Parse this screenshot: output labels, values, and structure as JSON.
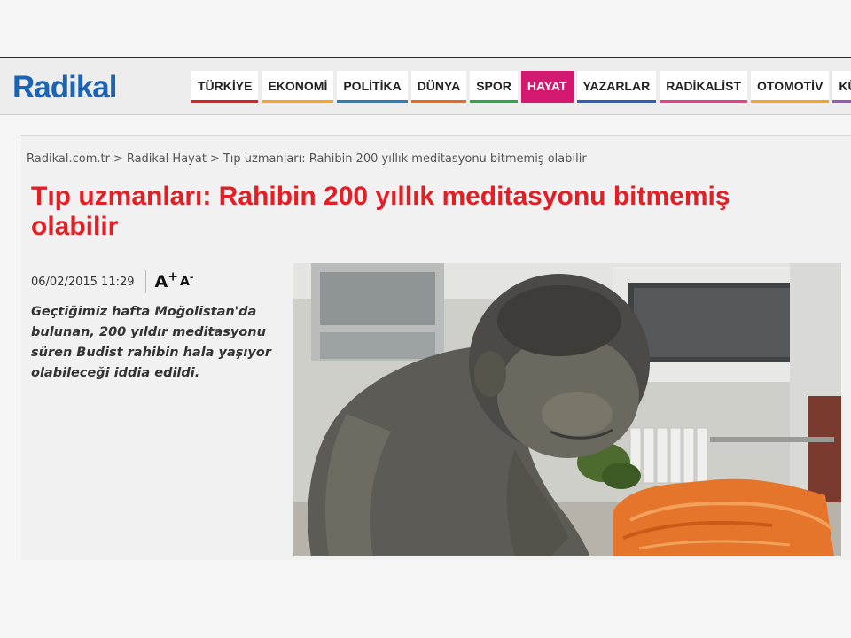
{
  "header": {
    "logo": "Radikal",
    "brand_color": "#1d63b3"
  },
  "nav": {
    "items": [
      {
        "label": "TÜRKİYE",
        "color": "#e31e24",
        "active": false
      },
      {
        "label": "EKONOMİ",
        "color": "#f5a623",
        "active": false
      },
      {
        "label": "POLİTİKA",
        "color": "#2a7fc1",
        "active": false
      },
      {
        "label": "DÜNYA",
        "color": "#e86a1e",
        "active": false
      },
      {
        "label": "SPOR",
        "color": "#2aa84a",
        "active": false
      },
      {
        "label": "HAYAT",
        "color": "#d2186f",
        "active": true
      },
      {
        "label": "YAZARLAR",
        "color": "#2a5ec1",
        "active": false
      },
      {
        "label": "RADİKALİST",
        "color": "#e83e8c",
        "active": false
      },
      {
        "label": "OTOMOTİV",
        "color": "#f5a623",
        "active": false
      },
      {
        "label": "KÜLTÜR",
        "color": "#9b59b6",
        "active": false
      }
    ]
  },
  "breadcrumb": {
    "items": [
      "Radikal.com.tr",
      "Radikal Hayat",
      "Tıp uzmanları: Rahibin 200 yıllık meditasyonu bitmemiş olabilir"
    ],
    "separator": ">"
  },
  "article": {
    "title": "Tıp uzmanları: Rahibin 200 yıllık meditasyonu bitmemiş olabilir",
    "title_color": "#e31e24",
    "date": "06/02/2015 11:29",
    "font_increase": {
      "letter": "A",
      "sign": "+"
    },
    "font_decrease": {
      "letter": "A",
      "sign": "-"
    },
    "summary": "Geçtiğimiz hafta Moğolistan'da bulunan, 200 yıldır meditasyonu süren Budist rahibin hala yaşıyor olabileceği iddia edildi."
  }
}
